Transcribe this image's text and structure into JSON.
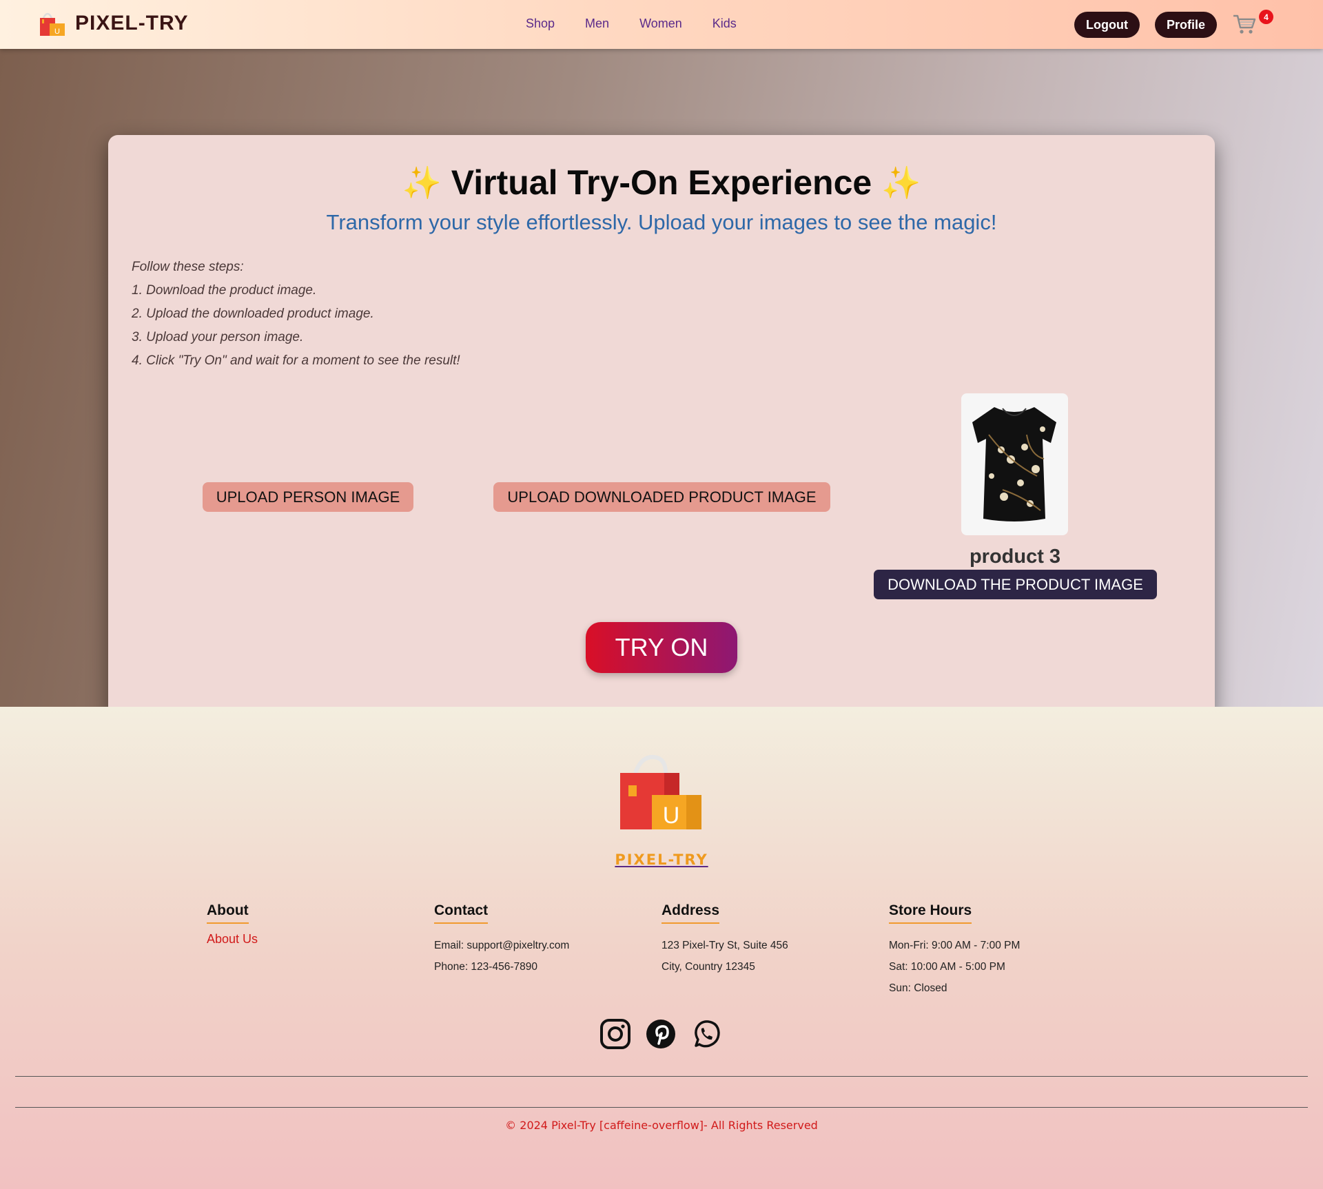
{
  "header": {
    "brand": "PIXEL-TRY",
    "nav": [
      "Shop",
      "Men",
      "Women",
      "Kids"
    ],
    "logout_label": "Logout",
    "profile_label": "Profile",
    "cart_count": "4"
  },
  "main": {
    "title": "Virtual Try-On Experience",
    "sparkle": "✨",
    "subtitle": "Transform your style effortlessly. Upload your images to see the magic!",
    "steps": [
      "Follow these steps:",
      "1. Download the product image.",
      "2. Upload the downloaded product image.",
      "3. Upload your person image.",
      "4. Click \"Try On\" and wait for a moment to see the result!"
    ],
    "upload_person_label": "UPLOAD PERSON IMAGE",
    "upload_product_label": "UPLOAD DOWNLOADED PRODUCT IMAGE",
    "product_name": "product 3",
    "download_label": "DOWNLOAD THE PRODUCT IMAGE",
    "try_on_label": "TRY ON"
  },
  "footer": {
    "brand": "PIXEL-TRY",
    "about": {
      "heading": "About",
      "link": "About Us"
    },
    "contact": {
      "heading": "Contact",
      "lines": [
        "Email: support@pixeltry.com",
        "Phone: 123-456-7890"
      ]
    },
    "address": {
      "heading": "Address",
      "lines": [
        "123 Pixel-Try St, Suite 456",
        "City, Country 12345"
      ]
    },
    "hours": {
      "heading": "Store Hours",
      "lines": [
        "Mon-Fri: 9:00 AM - 7:00 PM",
        "Sat: 10:00 AM - 5:00 PM",
        "Sun: Closed"
      ]
    },
    "social_icons": [
      "instagram-icon",
      "pinterest-icon",
      "whatsapp-icon"
    ],
    "copyright": "© 2024 Pixel-Try [caffeine-overflow]- All Rights Reserved"
  },
  "colors": {
    "accent_red": "#d90f27",
    "accent_purple": "#8d1873",
    "brand_orange": "#ef9a1f",
    "dark_button": "#2c0f14"
  }
}
